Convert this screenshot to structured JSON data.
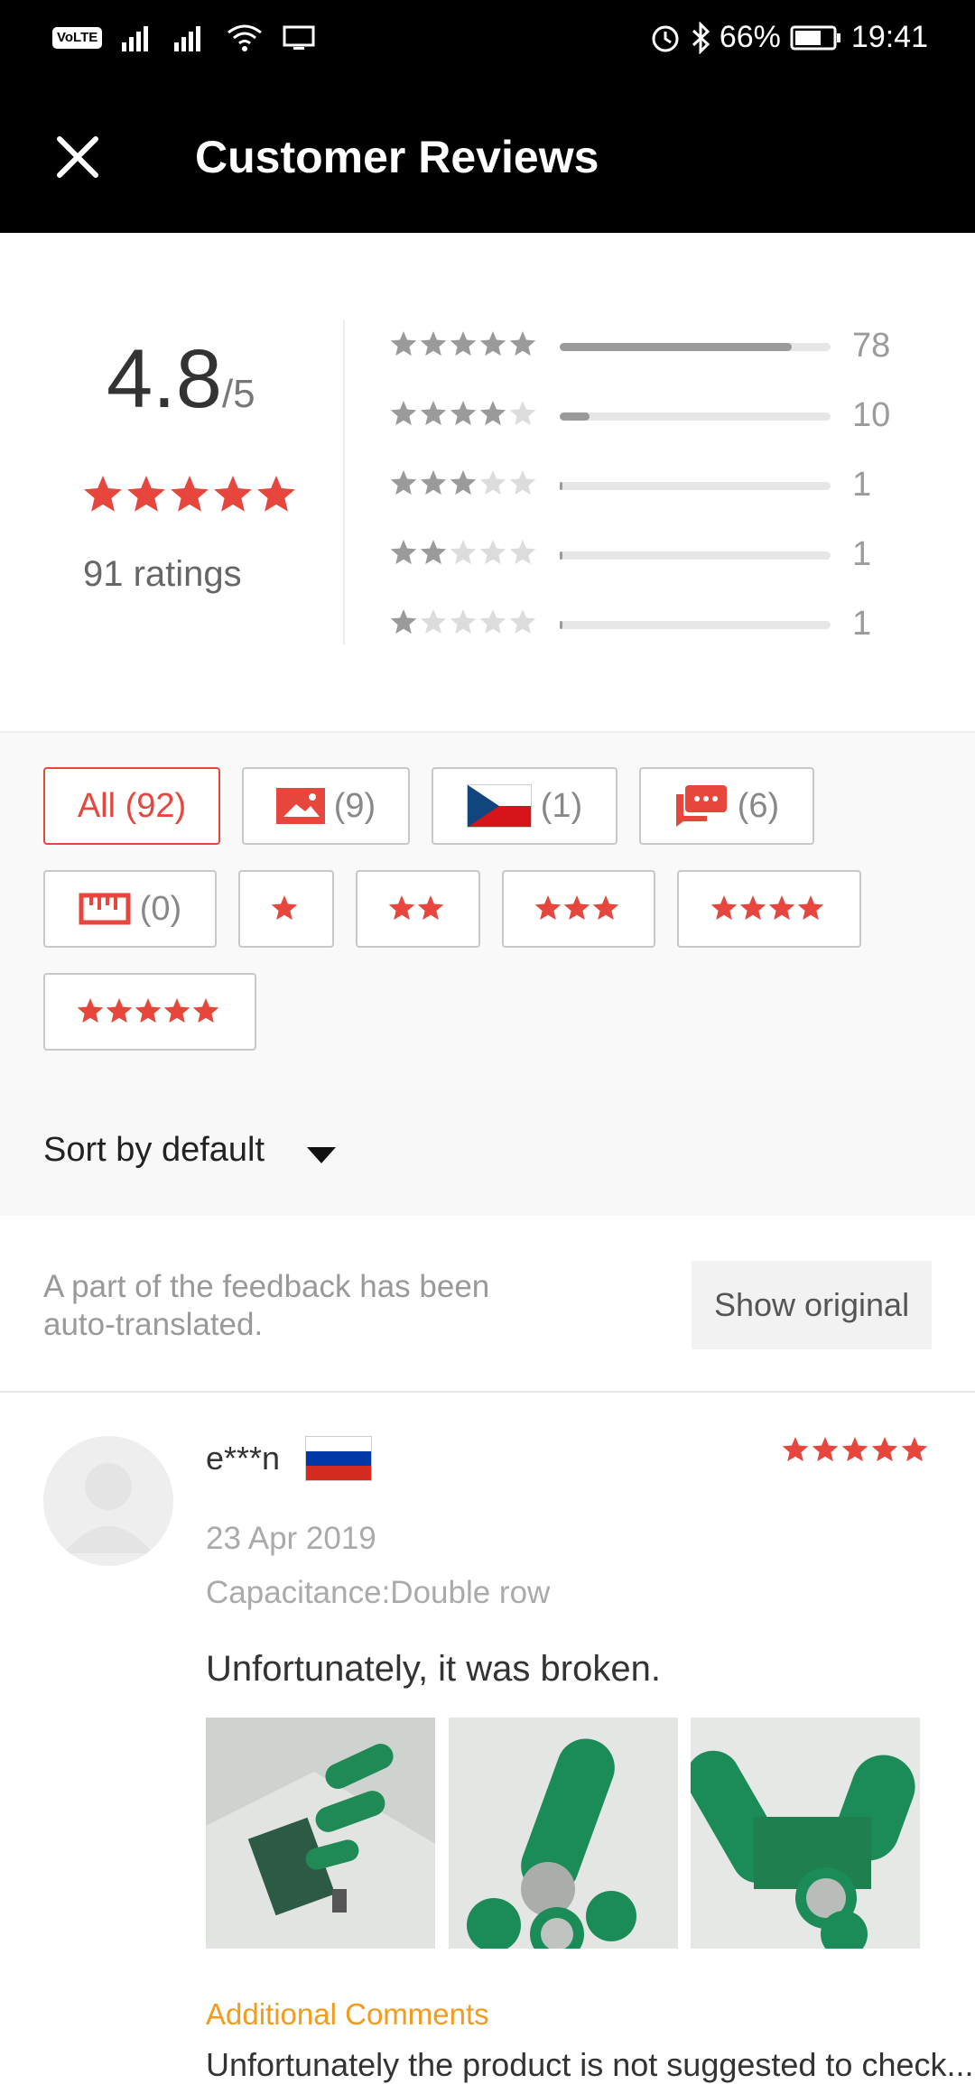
{
  "status_bar": {
    "volte": "VoLTE",
    "battery": "66%",
    "time": "19:41"
  },
  "app_bar": {
    "title": "Customer Reviews",
    "close_icon": "close-icon"
  },
  "summary": {
    "score": "4.8",
    "score_suffix": "/5",
    "average_stars": 5,
    "ratings_text": "91 ratings",
    "distribution": [
      {
        "stars": 5,
        "count": "78",
        "fill_fraction": 0.857
      },
      {
        "stars": 4,
        "count": "10",
        "fill_fraction": 0.11
      },
      {
        "stars": 3,
        "count": "1",
        "fill_fraction": 0.011
      },
      {
        "stars": 2,
        "count": "1",
        "fill_fraction": 0.011
      },
      {
        "stars": 1,
        "count": "1",
        "fill_fraction": 0.011
      }
    ]
  },
  "filters": {
    "all": "All (92)",
    "photos": "(9)",
    "country": "(1)",
    "comments": "(6)",
    "size": "(0)",
    "star_chips": [
      1,
      2,
      3,
      4,
      5
    ]
  },
  "sort": {
    "label": "Sort by default"
  },
  "translation": {
    "note": "A part of the feedback has been auto-translated.",
    "button": "Show original"
  },
  "review": {
    "author": "e***n",
    "stars": 5,
    "date": "23 Apr 2019",
    "variant": "Capacitance:Double row",
    "text": "Unfortunately, it was broken.",
    "additional_label": "Additional Comments",
    "additional_text": "Unfortunately the product is not suggested to check..."
  },
  "colors": {
    "accent": "#e6463c",
    "star_gray": "#c4c4c4",
    "comments_orange": "#f29b1d"
  }
}
